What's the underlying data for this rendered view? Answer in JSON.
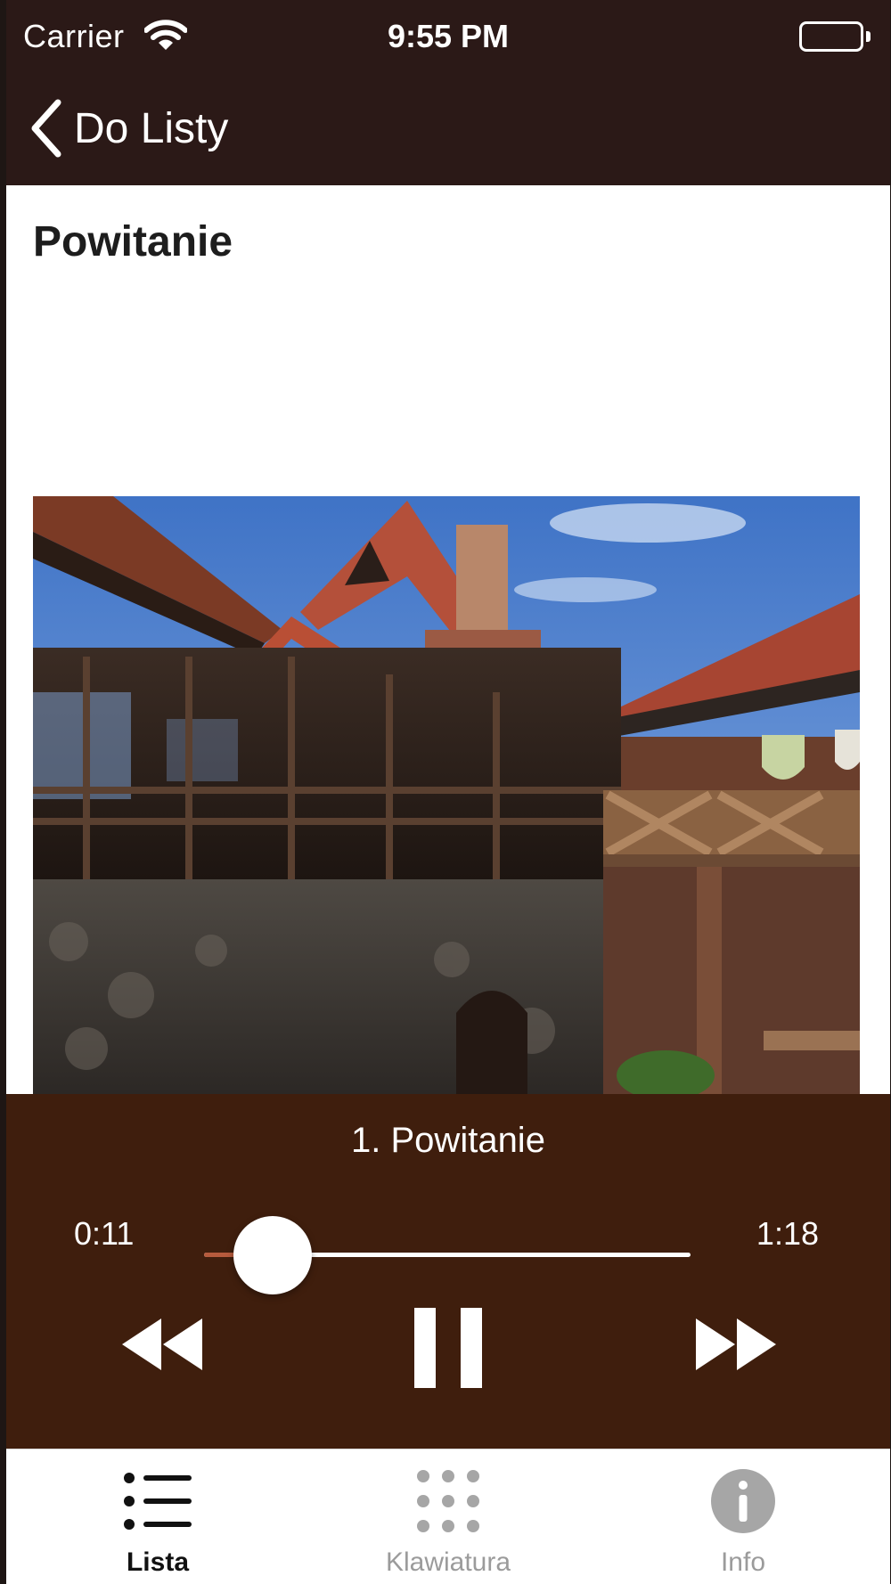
{
  "status_bar": {
    "carrier": "Carrier",
    "time": "9:55 PM"
  },
  "nav": {
    "back_label": "Do Listy",
    "back_icon": "chevron-left-icon"
  },
  "content": {
    "title": "Powitanie",
    "image_alt": "castle courtyard with wooden galleries and red tiled roofs"
  },
  "player": {
    "track_title": "1. Powitanie",
    "elapsed": "0:11",
    "total": "1:18",
    "progress_fraction": 0.141,
    "state": "playing",
    "accent_color": "#b65b3d",
    "background_color": "#3f1e0d"
  },
  "tabs": [
    {
      "label": "Lista",
      "icon": "list-icon",
      "active": true
    },
    {
      "label": "Klawiatura",
      "icon": "keypad-icon",
      "active": false
    },
    {
      "label": "Info",
      "icon": "info-icon",
      "active": false
    }
  ],
  "colors": {
    "nav_background": "#2b1917",
    "player_background": "#3f1e0d",
    "accent": "#b65b3d"
  }
}
